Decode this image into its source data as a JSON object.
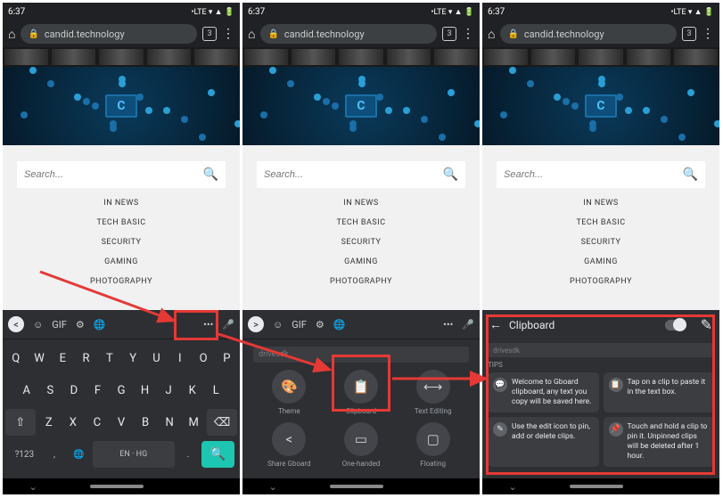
{
  "status": {
    "time": "6:37",
    "icons": "•LTE ▾ ▲ 🔋"
  },
  "url": {
    "domain": "candid.technology",
    "tabs": "3"
  },
  "page": {
    "search_placeholder": "Search...",
    "nav": [
      "IN NEWS",
      "TECH BASIC",
      "SECURITY",
      "GAMING",
      "PHOTOGRAPHY"
    ],
    "hero_logo": "C"
  },
  "keyboard": {
    "tabs": {
      "gif": "GIF",
      "more": "•••"
    },
    "row1": [
      "Q",
      "W",
      "E",
      "R",
      "T",
      "Y",
      "U",
      "I",
      "O",
      "P"
    ],
    "row2": [
      "A",
      "S",
      "D",
      "F",
      "G",
      "H",
      "J",
      "K",
      "L"
    ],
    "row3_shift": "⇧",
    "row3": [
      "Z",
      "X",
      "C",
      "V",
      "B",
      "N",
      "M"
    ],
    "row3_del": "⌫",
    "sym": "?123",
    "comma": ",",
    "space": "EN · HG",
    "period": "."
  },
  "quicktools": {
    "hint": "drivesdk",
    "items": [
      {
        "icon": "🎨",
        "label": "Theme"
      },
      {
        "icon": "📋",
        "label": "Clipboard"
      },
      {
        "icon": "⟷",
        "label": "Text Editing"
      },
      {
        "icon": "<",
        "label": "Share Gboard"
      },
      {
        "icon": "▭",
        "label": "One-handed"
      },
      {
        "icon": "▢",
        "label": "Floating"
      }
    ]
  },
  "clipboard": {
    "title": "Clipboard",
    "hint": "drivesdk",
    "tips_label": "TIPS",
    "cards": [
      {
        "icon": "💬",
        "text": "Welcome to Gboard clipboard, any text you copy will be saved here."
      },
      {
        "icon": "📋",
        "text": "Tap on a clip to paste it in the text box."
      },
      {
        "icon": "✎",
        "text": "Use the edit icon to pin, add or delete clips."
      },
      {
        "icon": "📌",
        "text": "Touch and hold a clip to pin it. Unpinned clips will be deleted after 1 hour."
      }
    ]
  }
}
